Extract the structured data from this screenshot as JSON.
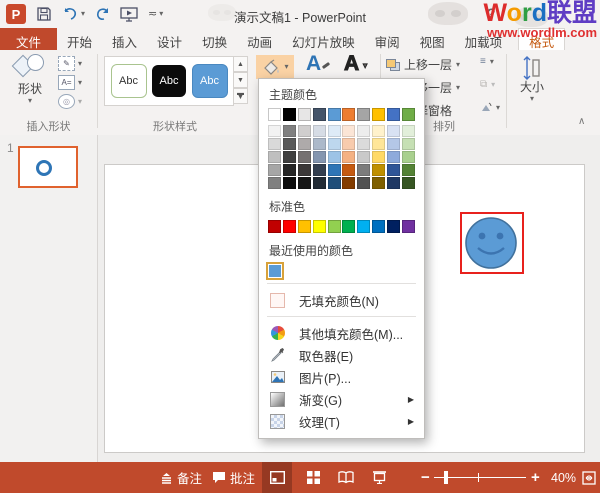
{
  "titlebar": {
    "title": "演示文稿1 - PowerPoint",
    "help": "?",
    "watermark_letters": [
      {
        "ch": "W",
        "color": "#DD2C2C"
      },
      {
        "ch": "o",
        "color": "#F59B00"
      },
      {
        "ch": "r",
        "color": "#2F9E44"
      },
      {
        "ch": "d",
        "color": "#1B6FC2"
      },
      {
        "ch": "联",
        "color": "#5F3DC4"
      },
      {
        "ch": "盟",
        "color": "#5F3DC4"
      }
    ],
    "watermark_url": "www.wordlm.com"
  },
  "tabs": [
    {
      "label": "文件"
    },
    {
      "label": "开始"
    },
    {
      "label": "插入"
    },
    {
      "label": "设计"
    },
    {
      "label": "切换"
    },
    {
      "label": "动画"
    },
    {
      "label": "幻灯片放映"
    },
    {
      "label": "审阅"
    },
    {
      "label": "视图"
    },
    {
      "label": "加载项"
    },
    {
      "label": "格式"
    }
  ],
  "ribbon": {
    "insert_shapes": {
      "group_label": "插入形状",
      "shapes_label": "形状"
    },
    "shape_styles": {
      "group_label": "形状样式",
      "gallery": [
        "Abc",
        "Abc",
        "Abc"
      ]
    },
    "wordart": {
      "fill_a": "A",
      "outline_a": "A"
    },
    "arrange": {
      "group_label": "排列",
      "bring_forward": "上移一层",
      "send_backward": "下移一层",
      "selection_pane": "选择窗格"
    },
    "size": {
      "group_label": "大小"
    }
  },
  "slides_panel": {
    "slide_number": "1"
  },
  "fill_menu": {
    "theme_header": "主题颜色",
    "theme_colors": [
      "#FFFFFF",
      "#000000",
      "#E7E6E6",
      "#44546A",
      "#5B9BD5",
      "#ED7D31",
      "#A5A5A5",
      "#FFC000",
      "#4472C4",
      "#70AD47"
    ],
    "theme_variants": [
      [
        "#F2F2F2",
        "#D9D9D9",
        "#BFBFBF",
        "#A6A6A6",
        "#808080"
      ],
      [
        "#808080",
        "#595959",
        "#404040",
        "#262626",
        "#0D0D0D"
      ],
      [
        "#D0CECE",
        "#AEAAAA",
        "#757171",
        "#3B3838",
        "#161616"
      ],
      [
        "#D6DCE5",
        "#ACB9CA",
        "#8496B0",
        "#333F50",
        "#222B35"
      ],
      [
        "#DEEBF7",
        "#BDD7EE",
        "#9DC3E6",
        "#2E75B6",
        "#1F4E79"
      ],
      [
        "#FBE5D6",
        "#F8CBAD",
        "#F4B183",
        "#C55A11",
        "#833C00"
      ],
      [
        "#EDEDED",
        "#DBDBDB",
        "#C9C9C9",
        "#7C7C7C",
        "#525252"
      ],
      [
        "#FFF2CC",
        "#FFE699",
        "#FFD966",
        "#BF9000",
        "#7F6000"
      ],
      [
        "#D9E2F3",
        "#B4C7E7",
        "#8EAADB",
        "#2F5597",
        "#1F3864"
      ],
      [
        "#E2EFDA",
        "#C6E0B4",
        "#A9D08E",
        "#548235",
        "#375623"
      ]
    ],
    "standard_header": "标准色",
    "standard_colors": [
      "#C00000",
      "#FF0000",
      "#FFC000",
      "#FFFF00",
      "#92D050",
      "#00B050",
      "#00B0F0",
      "#0070C0",
      "#002060",
      "#7030A0"
    ],
    "recent_header": "最近使用的颜色",
    "recent_colors": [
      "#5B9BD5"
    ],
    "items": [
      {
        "label": "无填充颜色(N)"
      },
      {
        "label": "其他填充颜色(M)..."
      },
      {
        "label": "取色器(E)"
      },
      {
        "label": "图片(P)..."
      },
      {
        "label": "渐变(G)",
        "submenu": true
      },
      {
        "label": "纹理(T)",
        "submenu": true
      }
    ]
  },
  "statusbar": {
    "notes": "备注",
    "comments": "批注",
    "zoom_level": "40%"
  },
  "colors": {
    "app_accent": "#C0492C",
    "contextual_tab_text": "#C55A11",
    "smiley_fill": "#5B9BD5",
    "smiley_outline": "#41719C",
    "annotation_red": "#E8211D",
    "thumbnail_border": "#E0622E",
    "bucket_highlight": "#FAD2A4",
    "recent_selected_ring": "#D8A23A"
  }
}
